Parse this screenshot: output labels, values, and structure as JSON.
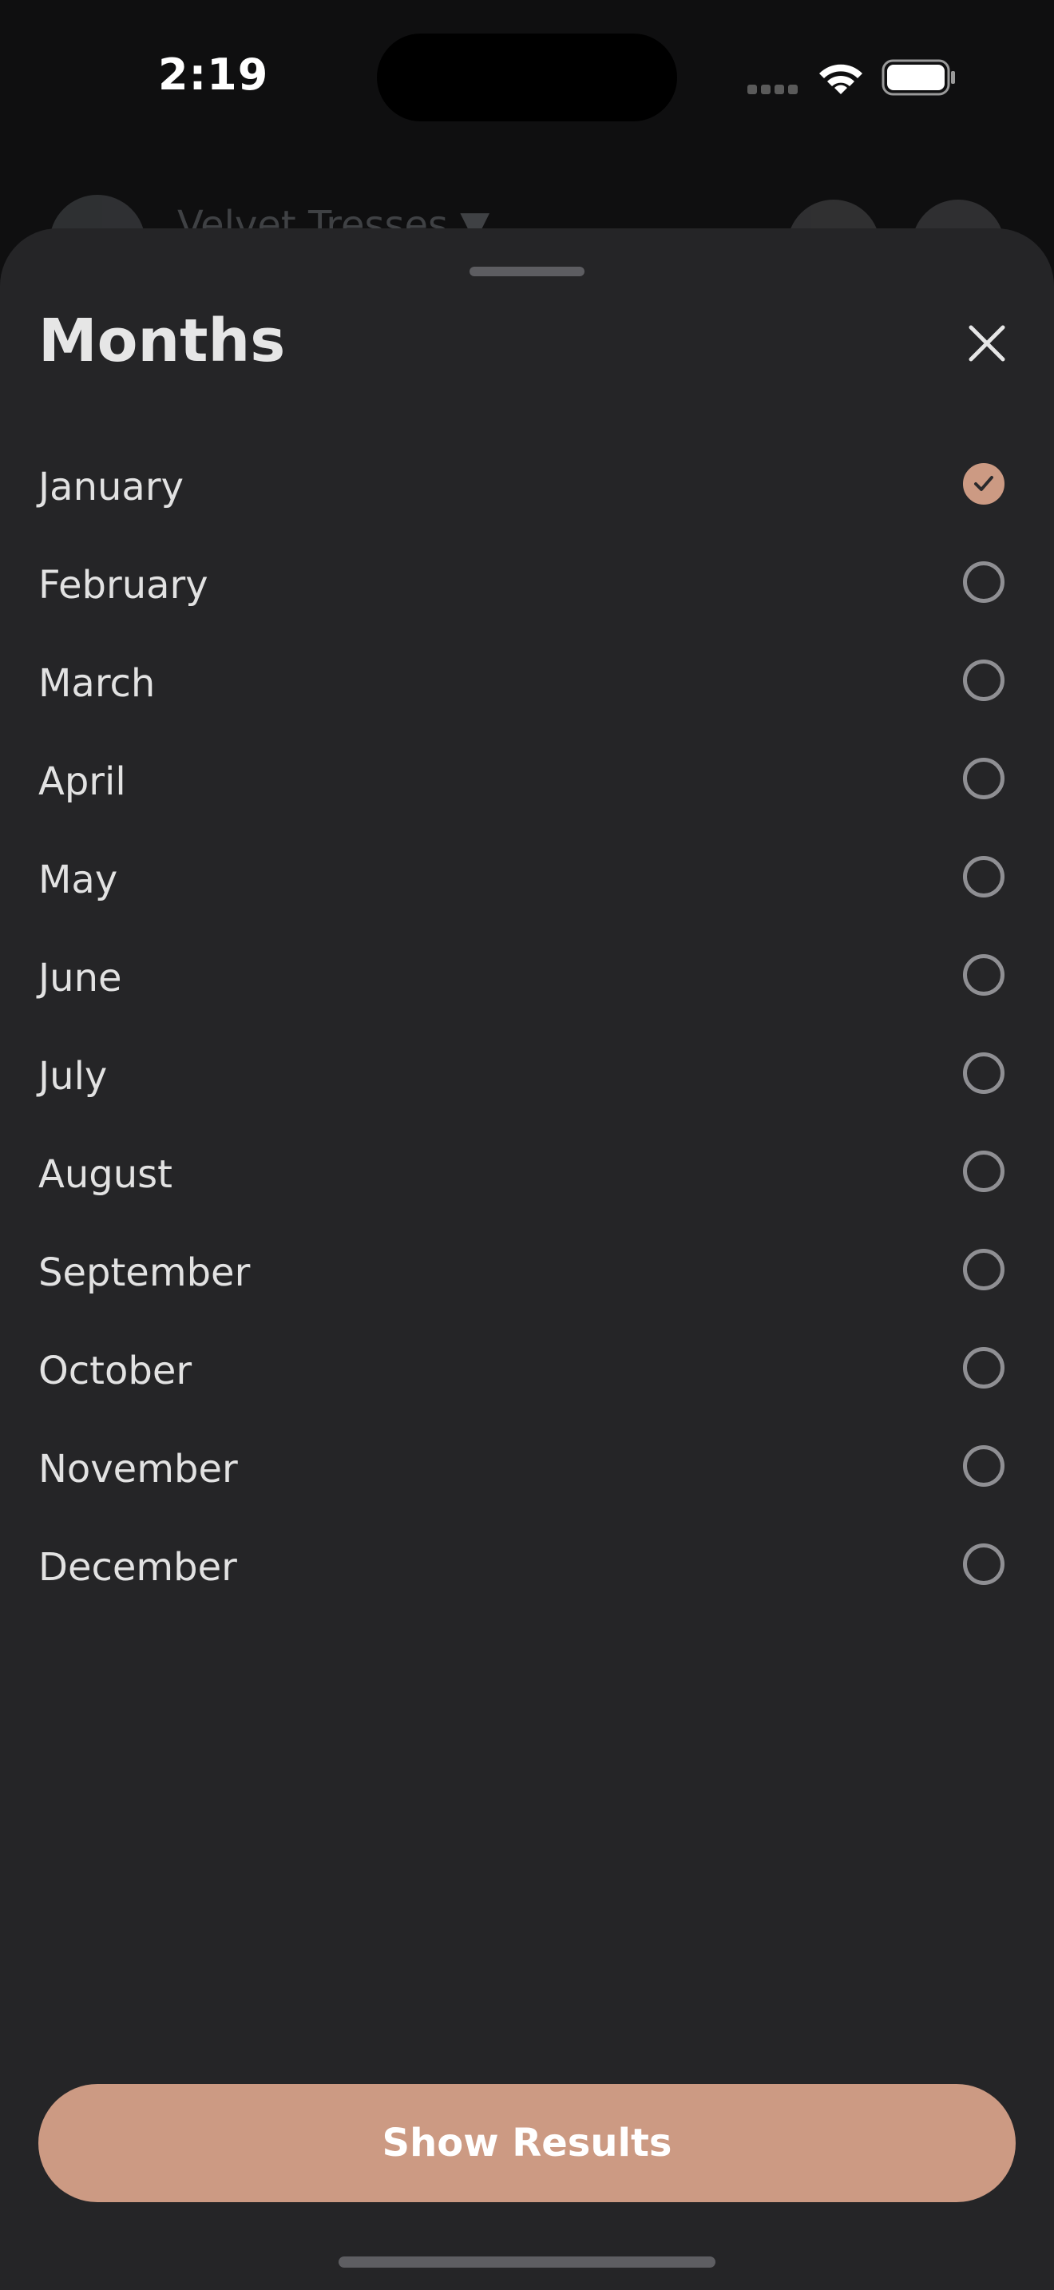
{
  "status_bar": {
    "time": "2:19"
  },
  "background_header": {
    "title": "Velvet Tresses ▼"
  },
  "sheet": {
    "title": "Months",
    "months": [
      {
        "label": "January",
        "selected": true
      },
      {
        "label": "February",
        "selected": false
      },
      {
        "label": "March",
        "selected": false
      },
      {
        "label": "April",
        "selected": false
      },
      {
        "label": "May",
        "selected": false
      },
      {
        "label": "June",
        "selected": false
      },
      {
        "label": "July",
        "selected": false
      },
      {
        "label": "August",
        "selected": false
      },
      {
        "label": "September",
        "selected": false
      },
      {
        "label": "October",
        "selected": false
      },
      {
        "label": "November",
        "selected": false
      },
      {
        "label": "December",
        "selected": false
      }
    ],
    "cta_label": "Show Results"
  },
  "colors": {
    "accent": "#cc9a83",
    "sheet_bg": "#252527",
    "radio_border": "#8f8f93"
  },
  "icons": [
    "close-icon",
    "checkmark-icon",
    "wifi-icon",
    "battery-icon",
    "signal-icon"
  ]
}
